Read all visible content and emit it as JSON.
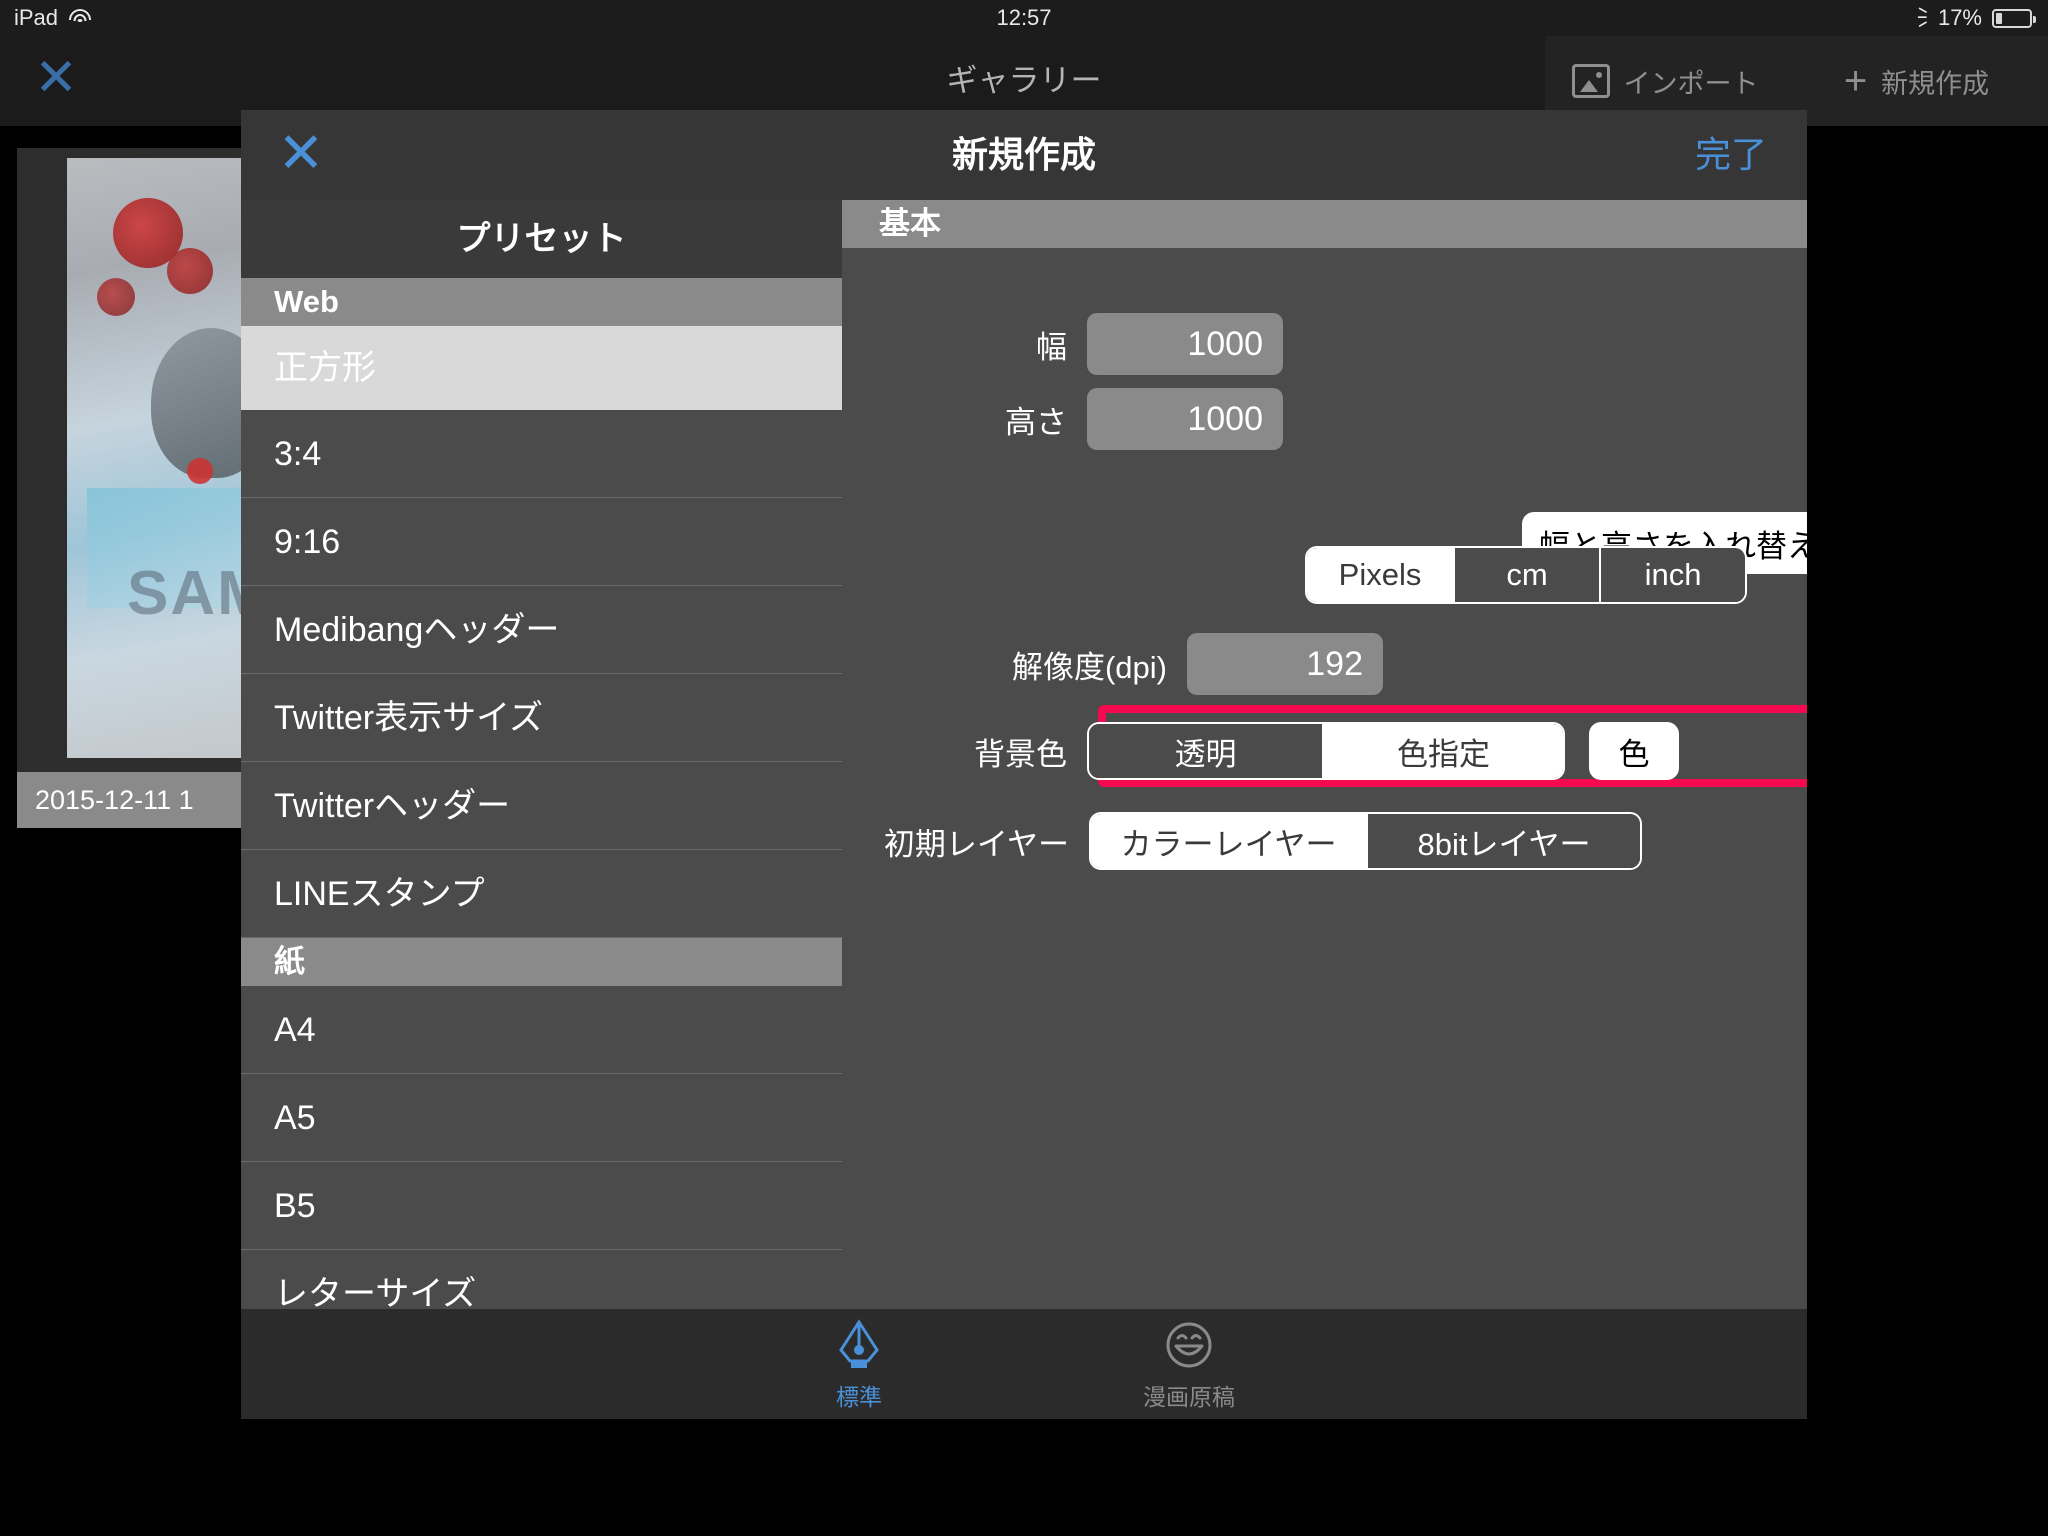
{
  "statusbar": {
    "carrier": "iPad",
    "wifi_icon": "wifi-icon",
    "time": "12:57",
    "bluetooth_icon": "bluetooth-icon",
    "battery_percent": "17%",
    "battery_icon": "battery-icon"
  },
  "gallery": {
    "close_icon": "close-icon",
    "title": "ギャラリー",
    "import_label": "インポート",
    "import_icon": "image-import-icon",
    "new_label": "新規作成",
    "new_icon": "plus-icon",
    "thumbnail_label": "2015-12-11 1",
    "thumbnail_watermark": "SAMPLE"
  },
  "modal": {
    "close_icon": "close-icon",
    "title": "新規作成",
    "done_label": "完了"
  },
  "presets": {
    "header": "プリセット",
    "groups": [
      {
        "name": "Web",
        "items": [
          {
            "label": "正方形",
            "selected": true
          },
          {
            "label": "3:4",
            "selected": false
          },
          {
            "label": "9:16",
            "selected": false
          },
          {
            "label": "Medibangヘッダー",
            "selected": false
          },
          {
            "label": "Twitter表示サイズ",
            "selected": false
          },
          {
            "label": "Twitterヘッダー",
            "selected": false
          },
          {
            "label": "LINEスタンプ",
            "selected": false
          }
        ]
      },
      {
        "name": "紙",
        "items": [
          {
            "label": "A4",
            "selected": false
          },
          {
            "label": "A5",
            "selected": false
          },
          {
            "label": "B5",
            "selected": false
          },
          {
            "label": "レターサイズ",
            "selected": false
          }
        ]
      }
    ]
  },
  "form": {
    "section_title": "基本",
    "width": {
      "label": "幅",
      "value": "1000"
    },
    "height": {
      "label": "高さ",
      "value": "1000"
    },
    "swap_button": "幅と高さを入れ替える",
    "units": {
      "options": [
        "Pixels",
        "cm",
        "inch"
      ],
      "selected": "Pixels"
    },
    "dpi": {
      "label": "解像度(dpi)",
      "value": "192"
    },
    "background": {
      "label": "背景色",
      "options": [
        "透明",
        "色指定"
      ],
      "selected": "色指定",
      "color_button": "色",
      "highlight_color": "#f5094f"
    },
    "initial_layer": {
      "label": "初期レイヤー",
      "options": [
        "カラーレイヤー",
        "8bitレイヤー"
      ],
      "selected": "カラーレイヤー"
    }
  },
  "tabbar": {
    "tabs": [
      {
        "label": "標準",
        "icon": "pen-nib-icon",
        "active": true
      },
      {
        "label": "漫画原稿",
        "icon": "smiley-face-icon",
        "active": false
      }
    ]
  }
}
